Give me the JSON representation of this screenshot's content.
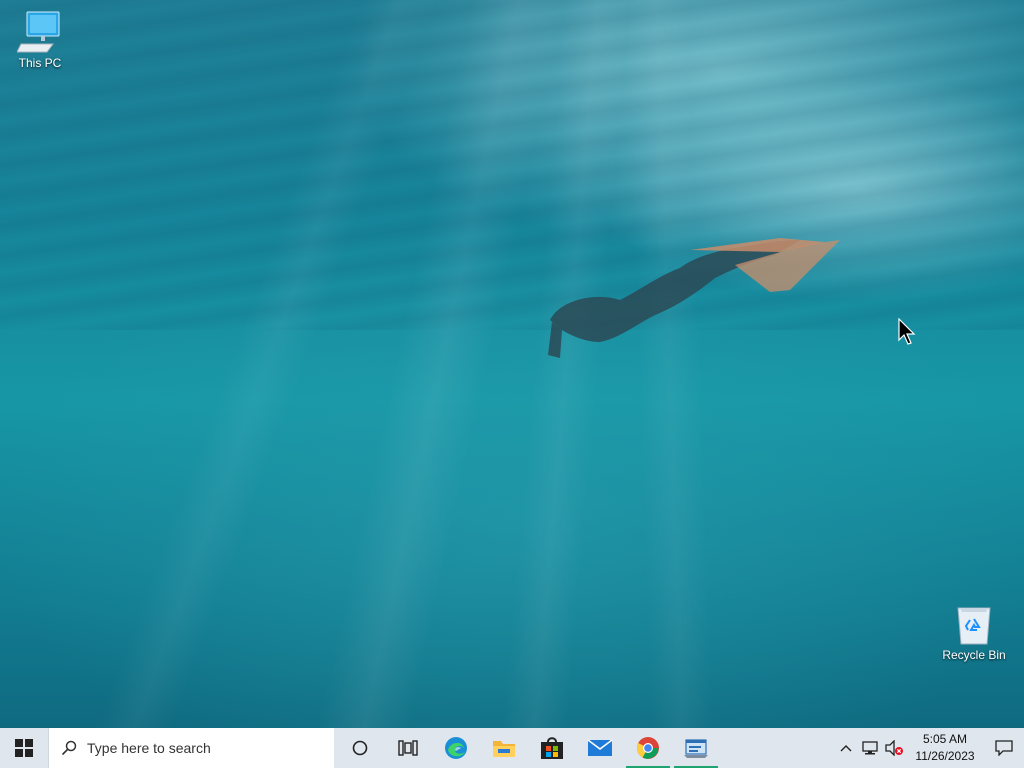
{
  "desktop": {
    "icons": [
      {
        "label": "This PC",
        "icon": "this-pc-icon"
      },
      {
        "label": "Recycle Bin",
        "icon": "recycle-bin-icon"
      }
    ]
  },
  "taskbar": {
    "search": {
      "placeholder": "Type here to search"
    },
    "pinned": [
      {
        "name": "cortana",
        "icon": "cortana-circle-icon"
      },
      {
        "name": "task-view",
        "icon": "task-view-icon"
      },
      {
        "name": "edge",
        "icon": "edge-icon"
      },
      {
        "name": "file-explorer",
        "icon": "folder-icon"
      },
      {
        "name": "microsoft-store",
        "icon": "store-bag-icon"
      },
      {
        "name": "mail",
        "icon": "mail-envelope-icon"
      },
      {
        "name": "chrome",
        "icon": "chrome-icon",
        "active": true
      },
      {
        "name": "app-window",
        "icon": "app-window-icon",
        "active": true
      }
    ],
    "tray": {
      "time": "5:05 AM",
      "date": "11/26/2023"
    }
  },
  "colors": {
    "taskbar_bg": "#dfe6ee",
    "active_indicator": "#1ea56f",
    "desktop_water": "#1797a6"
  }
}
